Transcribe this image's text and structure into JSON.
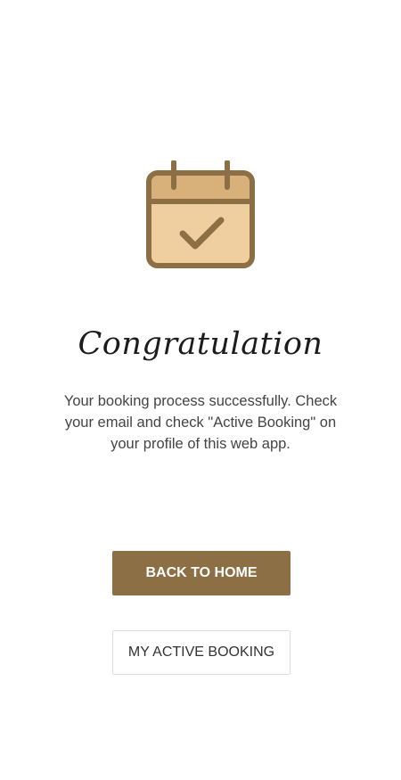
{
  "confirmation": {
    "icon": "calendar-check-icon",
    "title": "Congratulation",
    "message": "Your booking process successfully. Check your email and check \"Active Booking\" on your profile of this web app."
  },
  "actions": {
    "back_home_label": "BACK TO HOME",
    "active_booking_label": "MY ACTIVE BOOKING"
  },
  "colors": {
    "accent": "#8c6f44",
    "icon_fill": "#efcf9f",
    "icon_header": "#d7b07a",
    "icon_stroke": "#8c6f44"
  }
}
